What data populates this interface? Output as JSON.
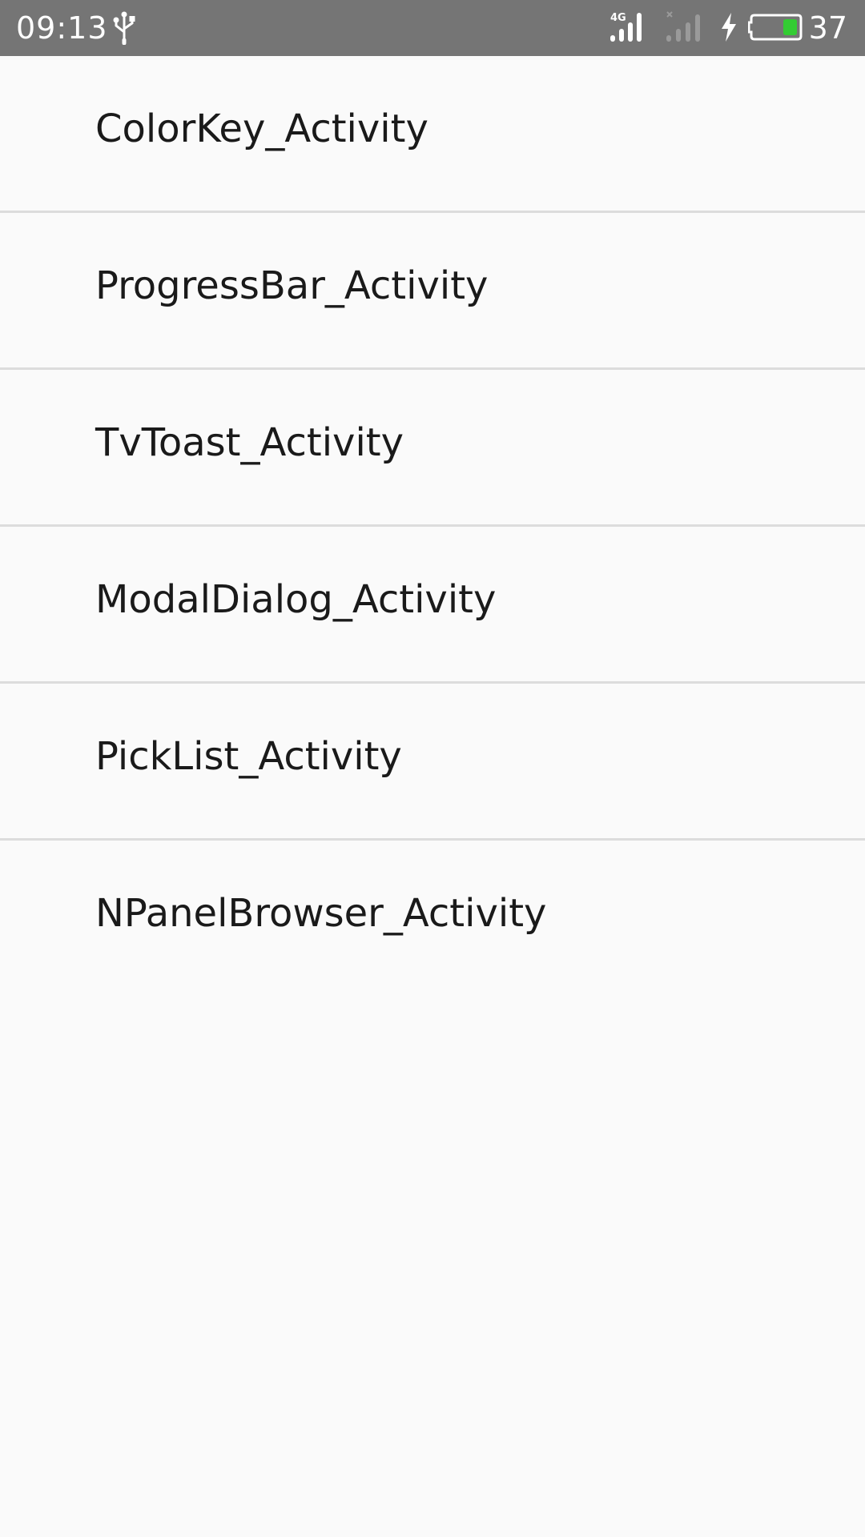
{
  "status_bar": {
    "time": "09:13",
    "network_type": "4G",
    "battery_level": "37",
    "icons": [
      "usb-icon",
      "signal-4g-icon",
      "signal-no-sim-icon",
      "charging-bolt-icon",
      "battery-icon"
    ],
    "colors": {
      "background": "#757575",
      "battery_fill": "#33cc33"
    }
  },
  "activity_list": {
    "items": [
      {
        "label": "ColorKey_Activity"
      },
      {
        "label": "ProgressBar_Activity"
      },
      {
        "label": "TvToast_Activity"
      },
      {
        "label": "ModalDialog_Activity"
      },
      {
        "label": "PickList_Activity"
      },
      {
        "label": "NPanelBrowser_Activity"
      }
    ]
  }
}
